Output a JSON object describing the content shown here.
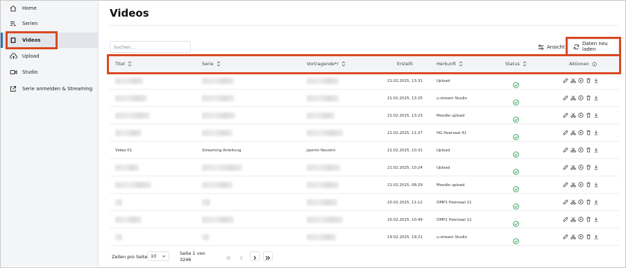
{
  "sidebar": {
    "items": [
      {
        "label": "Home",
        "icon": "home-icon"
      },
      {
        "label": "Serien",
        "icon": "playlist-icon"
      },
      {
        "label": "Videos",
        "icon": "video-file-icon",
        "active": true
      },
      {
        "label": "Upload",
        "icon": "cloud-upload-icon"
      },
      {
        "label": "Studio",
        "icon": "camera-icon"
      },
      {
        "label": "Serie anmelden & Streaming",
        "icon": "external-link-icon"
      }
    ]
  },
  "page": {
    "title": "Videos"
  },
  "toolbar": {
    "search_placeholder": "Suchen...",
    "view_label": "Ansicht",
    "reload_label": "Daten neu laden"
  },
  "table": {
    "headers": {
      "title": "Titel",
      "series": "Serie",
      "presenters": "Vortragende*r",
      "created": "Erstellt",
      "source": "Herkunft",
      "status": "Status",
      "actions": "Aktionen"
    },
    "rows": [
      {
        "title": "",
        "series": "",
        "presenters": "",
        "created": "21.02.2025, 13:31",
        "source": "Upload",
        "status": "ok"
      },
      {
        "title": "",
        "series": "",
        "presenters": "",
        "created": "21.02.2025, 13:25",
        "source": "u:stream Studio",
        "status": "ok"
      },
      {
        "title": "",
        "series": "",
        "presenters": "",
        "created": "21.02.2025, 13:23",
        "source": "Moodle upload",
        "status": "ok"
      },
      {
        "title": "",
        "series": "",
        "presenters": "",
        "created": "21.02.2025, 11:27",
        "source": "HG Hoersaal 41",
        "status": "ok"
      },
      {
        "title": "Video 01",
        "series": "Streaming Anleitung",
        "presenters": "Jasmin Novotni",
        "created": "21.02.2025, 10:31",
        "source": "Upload",
        "status": "ok"
      },
      {
        "title": "",
        "series": "",
        "presenters": "",
        "created": "21.02.2025, 10:24",
        "source": "Upload",
        "status": "ok"
      },
      {
        "title": "",
        "series": "",
        "presenters": "",
        "created": "21.02.2025, 08:29",
        "source": "Moodle upload",
        "status": "ok"
      },
      {
        "title": "",
        "series": "",
        "presenters": "",
        "created": "20.02.2025, 11:12",
        "source": "OMP1 Hoersaal 11",
        "status": "ok"
      },
      {
        "title": "",
        "series": "",
        "presenters": "",
        "created": "20.02.2025, 10:49",
        "source": "OMP1 Hoersaal 11",
        "status": "ok"
      },
      {
        "title": "",
        "series": "",
        "presenters": "",
        "created": "19.02.2025, 19:21",
        "source": "u:stream Studio",
        "status": "ok"
      }
    ]
  },
  "footer": {
    "rows_per_page_label": "Zeilen pro Seite",
    "rows_per_page_value": "10",
    "page_info_line1": "Seite 1 von",
    "page_info_line2": "3246"
  },
  "colors": {
    "accent": "#2b6fb5",
    "highlight": "#d9481f",
    "status_ok": "#3aa35b"
  }
}
